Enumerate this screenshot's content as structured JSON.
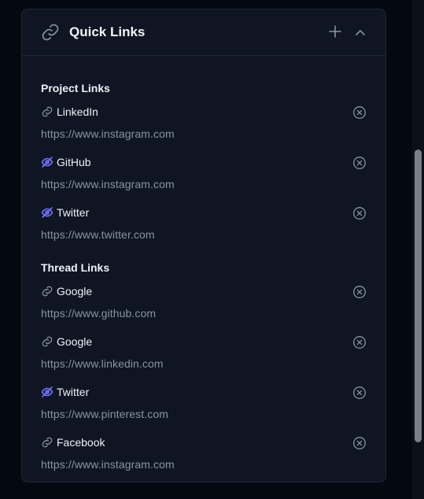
{
  "panel": {
    "title": "Quick Links",
    "header_icon": "link-icon",
    "add_icon": "plus-icon",
    "collapse_icon": "chevron-up-icon"
  },
  "sections": [
    {
      "title": "Project Links",
      "items": [
        {
          "name": "LinkedIn",
          "url": "https://www.instagram.com",
          "icon": "link-icon"
        },
        {
          "name": "GitHub",
          "url": "https://www.instagram.com",
          "icon": "eye-off-icon"
        },
        {
          "name": "Twitter",
          "url": "https://www.twitter.com",
          "icon": "eye-off-icon"
        }
      ]
    },
    {
      "title": "Thread Links",
      "items": [
        {
          "name": "Google",
          "url": "https://www.github.com",
          "icon": "link-icon"
        },
        {
          "name": "Google",
          "url": "https://www.linkedin.com",
          "icon": "link-icon"
        },
        {
          "name": "Twitter",
          "url": "https://www.pinterest.com",
          "icon": "eye-off-icon"
        },
        {
          "name": "Facebook",
          "url": "https://www.instagram.com",
          "icon": "link-icon"
        }
      ]
    }
  ],
  "colors": {
    "background": "#040810",
    "panel": "#0f1522",
    "border": "#1e2636",
    "text": "#eef1f7",
    "muted_text": "#8a93a3",
    "hidden_icon_accent": "#6f74ff",
    "icon_gray": "#8a93a3"
  }
}
